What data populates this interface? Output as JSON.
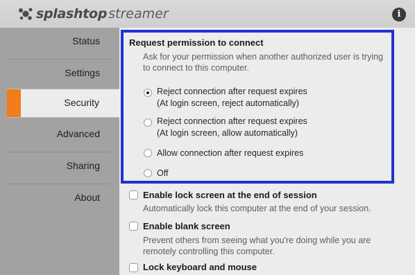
{
  "app": {
    "logo_brand": "splashtop",
    "logo_product": "streamer",
    "info_label": "i"
  },
  "sidebar": {
    "items": [
      {
        "label": "Status"
      },
      {
        "label": "Settings"
      },
      {
        "label": "Security"
      },
      {
        "label": "Advanced"
      },
      {
        "label": "Sharing"
      },
      {
        "label": "About"
      }
    ],
    "active_index": 2
  },
  "request_permission": {
    "title": "Request permission to connect",
    "desc_line1": "Ask for your permission when another authorized user is trying",
    "desc_line2": "to connect to this computer.",
    "options": [
      {
        "line1": "Reject connection after request expires",
        "line2": "(At login screen, reject automatically)",
        "selected": true
      },
      {
        "line1": "Reject connection after request expires",
        "line2": "(At login screen, allow automatically)",
        "selected": false
      },
      {
        "line1": "Allow connection after request expires",
        "line2": "",
        "selected": false
      },
      {
        "line1": "Off",
        "line2": "",
        "selected": false
      }
    ]
  },
  "lock_screen": {
    "label": "Enable lock screen at the end of session",
    "desc": "Automatically lock this computer at the end of your session.",
    "checked": false
  },
  "blank_screen": {
    "label": "Enable blank screen",
    "desc_line1": "Prevent others from seeing what you're doing while you are",
    "desc_line2": "remotely controlling this computer.",
    "checked": false
  },
  "lock_keyboard": {
    "label": "Lock keyboard and mouse",
    "checked": false
  },
  "colors": {
    "accent": "#f07d1a",
    "highlight_border": "#2131d2",
    "sidebar_bg": "#a2a2a2"
  }
}
